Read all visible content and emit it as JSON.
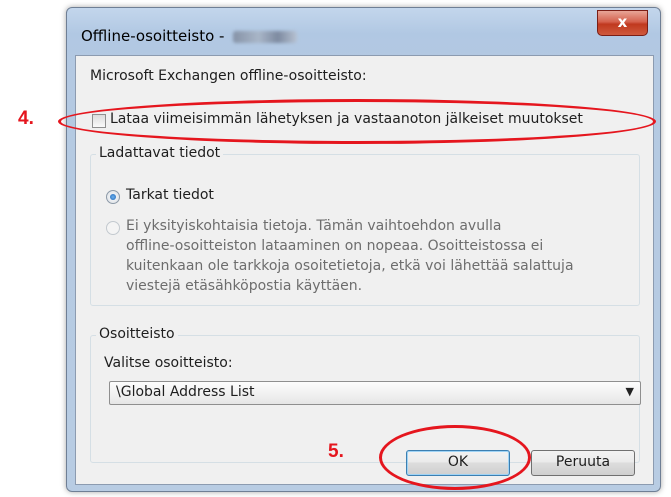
{
  "window": {
    "title": "Offline-osoitteisto - ",
    "close_label": "x"
  },
  "header_label": "Microsoft Exchangen offline-osoitteisto:",
  "download_checkbox": {
    "label": "Lataa viimeisimmän lähetyksen ja vastaanoton jälkeiset muutokset",
    "checked": false
  },
  "details_group": {
    "title": "Ladattavat tiedot",
    "options": [
      {
        "label": "Tarkat tiedot",
        "selected": true,
        "enabled": true
      },
      {
        "lines": [
          "Ei yksityiskohtaisia tietoja. Tämän vaihtoehdon avulla",
          "offline-osoitteiston lataaminen on nopeaa. Osoitteistossa ei",
          "kuitenkaan ole tarkkoja osoitetietoja, etkä voi lähettää salattuja",
          "viestejä etäsähköpostia käyttäen."
        ],
        "selected": false,
        "enabled": false
      }
    ]
  },
  "address_group": {
    "title": "Osoitteisto",
    "select_label": "Valitse osoitteisto:",
    "selected_value": "\\Global Address List"
  },
  "buttons": {
    "ok": "OK",
    "cancel": "Peruuta"
  },
  "annotations": {
    "step4": "4.",
    "step5": "5.",
    "color": "#e5161e"
  }
}
